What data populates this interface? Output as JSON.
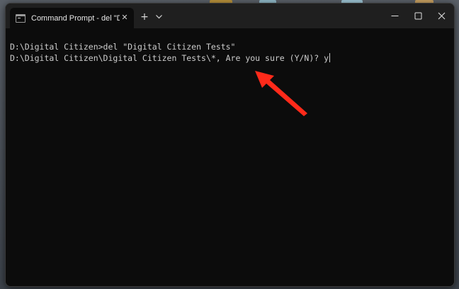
{
  "window": {
    "tab_title": "Command Prompt - del  \"Digi",
    "tab_close_glyph": "✕",
    "new_tab_glyph": "+"
  },
  "terminal": {
    "lines": [
      "D:\\Digital Citizen>del \"Digital Citizen Tests\"",
      "D:\\Digital Citizen\\Digital Citizen Tests\\*, Are you sure (Y/N)? y"
    ]
  },
  "colors": {
    "background": "#0c0c0c",
    "titlebar": "#1f1f1f",
    "text": "#cccccc",
    "annotation_arrow": "#ff2a1a"
  },
  "icons": {
    "tab": "terminal-icon",
    "dropdown": "chevron-down-icon",
    "minimize": "minimize-icon",
    "maximize": "maximize-icon",
    "close": "close-icon",
    "annotation": "red-arrow-icon"
  }
}
